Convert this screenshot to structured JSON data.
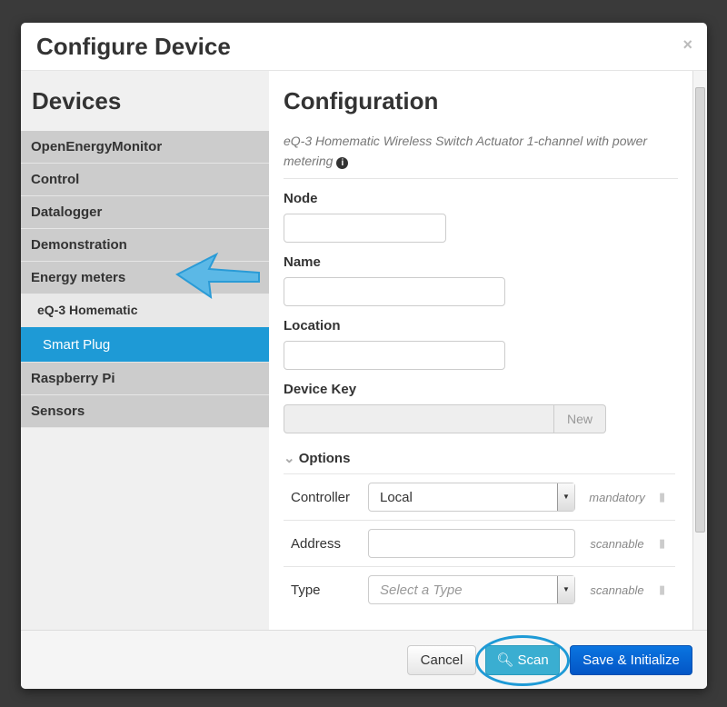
{
  "modal": {
    "title": "Configure Device",
    "close": "×"
  },
  "sidebar": {
    "title": "Devices",
    "items": [
      {
        "label": "OpenEnergyMonitor"
      },
      {
        "label": "Control"
      },
      {
        "label": "Datalogger"
      },
      {
        "label": "Demonstration"
      },
      {
        "label": "Energy meters"
      },
      {
        "label": "eQ-3 Homematic"
      },
      {
        "label": "Smart Plug"
      },
      {
        "label": "Raspberry Pi"
      },
      {
        "label": "Sensors"
      }
    ]
  },
  "config": {
    "title": "Configuration",
    "description": "eQ-3 Homematic Wireless Switch Actuator 1-channel with power metering",
    "node_label": "Node",
    "node_value": "",
    "name_label": "Name",
    "name_value": "",
    "location_label": "Location",
    "location_value": "",
    "key_label": "Device Key",
    "key_value": "",
    "new_button": "New",
    "options_label": "Options",
    "options": [
      {
        "label": "Controller",
        "value": "Local",
        "tag": "mandatory"
      },
      {
        "label": "Address",
        "value": "",
        "tag": "scannable"
      },
      {
        "label": "Type",
        "placeholder": "Select a Type",
        "tag": "scannable"
      }
    ]
  },
  "footer": {
    "cancel": "Cancel",
    "scan": "Scan",
    "save": "Save & Initialize"
  },
  "colors": {
    "accent": "#1e9ad6",
    "save": "#0356c6",
    "scan": "#3aaed1"
  }
}
